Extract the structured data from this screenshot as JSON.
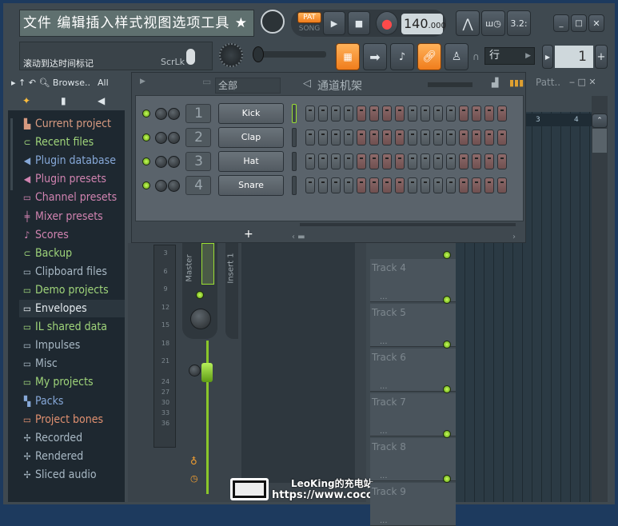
{
  "toolbar": {
    "menu_text": "文件 编辑插入样式视图选项工具 ★",
    "pat_label": "PAT",
    "song_label": "SONG",
    "tempo": "140",
    "tempo_decimal": ".000",
    "hint_text": "滚动到达时间标记",
    "scrlk_label": "ScrLk",
    "snap_value": "行",
    "pattern_number": "1",
    "time_display": "3.2:"
  },
  "browser": {
    "header_label": "Browse..",
    "filter_label": "All",
    "items": [
      {
        "label": "Current project",
        "color": "#d79a80",
        "icon": "project-icon"
      },
      {
        "label": "Recent files",
        "color": "#9fd47a",
        "icon": "recent-folder-icon"
      },
      {
        "label": "Plugin database",
        "color": "#86a8d8",
        "icon": "plugin-icon"
      },
      {
        "label": "Plugin presets",
        "color": "#d083b0",
        "icon": "plugin-icon"
      },
      {
        "label": "Channel presets",
        "color": "#d083b0",
        "icon": "channel-icon"
      },
      {
        "label": "Mixer presets",
        "color": "#d083b0",
        "icon": "mixer-icon"
      },
      {
        "label": "Scores",
        "color": "#d083b0",
        "icon": "note-icon"
      },
      {
        "label": "Backup",
        "color": "#9fd47a",
        "icon": "recent-folder-icon"
      },
      {
        "label": "Clipboard files",
        "color": "#a8b8c4",
        "icon": "folder-icon"
      },
      {
        "label": "Demo projects",
        "color": "#9fd47a",
        "icon": "folder-icon"
      },
      {
        "label": "Envelopes",
        "color": "#e6ecf0",
        "icon": "folder-icon"
      },
      {
        "label": "IL shared data",
        "color": "#9fd47a",
        "icon": "folder-icon"
      },
      {
        "label": "Impulses",
        "color": "#a8b8c4",
        "icon": "folder-icon"
      },
      {
        "label": "Misc",
        "color": "#a8b8c4",
        "icon": "folder-icon"
      },
      {
        "label": "My projects",
        "color": "#9fd47a",
        "icon": "folder-icon"
      },
      {
        "label": "Packs",
        "color": "#86a8d8",
        "icon": "packs-icon"
      },
      {
        "label": "Project bones",
        "color": "#e09070",
        "icon": "folder-icon"
      },
      {
        "label": "Recorded",
        "color": "#a8b8c4",
        "icon": "audio-icon"
      },
      {
        "label": "Rendered",
        "color": "#a8b8c4",
        "icon": "audio-icon"
      },
      {
        "label": "Sliced audio",
        "color": "#a8b8c4",
        "icon": "audio-icon"
      }
    ],
    "selected": "Envelopes"
  },
  "channel_rack": {
    "filter": "全部",
    "title": "通道机架",
    "channels": [
      {
        "number": "1",
        "name": "Kick"
      },
      {
        "number": "2",
        "name": "Clap"
      },
      {
        "number": "3",
        "name": "Hat"
      },
      {
        "number": "4",
        "name": "Snare"
      }
    ],
    "add_label": "+",
    "steps_per_row": 16
  },
  "playlist": {
    "title": "Patt..",
    "bar_labels": [
      "3",
      "4"
    ],
    "tracks": [
      "Track 4",
      "Track 5",
      "Track 6",
      "Track 7",
      "Track 8",
      "Track 9"
    ],
    "track_dots": "..."
  },
  "mixer": {
    "master_label": "Master",
    "insert_label": "Insert 1",
    "db_ticks": [
      "3",
      "6",
      "9",
      "12",
      "15",
      "18",
      "21",
      "24",
      "27",
      "30",
      "33",
      "36"
    ]
  },
  "watermark": {
    "line1": "LeoKing的充电站",
    "line2": "https://www.cocokl.cn"
  },
  "colors": {
    "accent_orange": "#f59a38",
    "led_green": "#9be033",
    "step_red": "#7e5c5c"
  }
}
